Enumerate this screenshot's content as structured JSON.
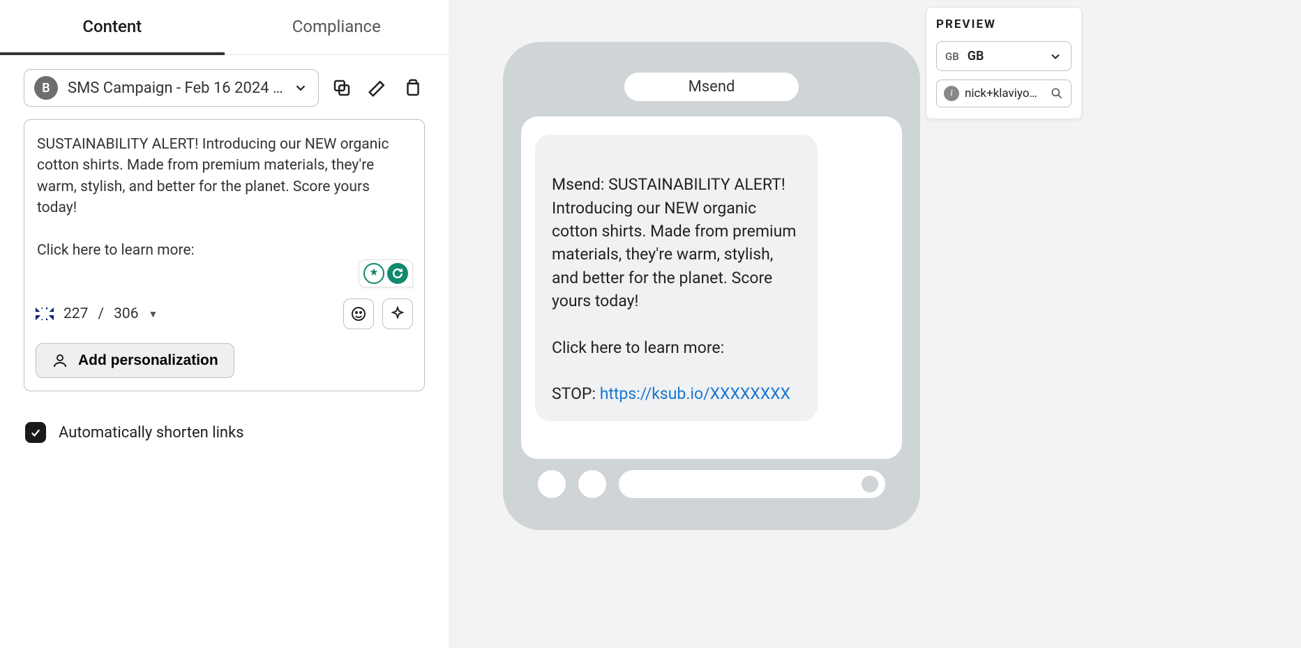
{
  "tabs": {
    "content": "Content",
    "compliance": "Compliance"
  },
  "campaign": {
    "badge": "B",
    "name": "SMS Campaign - Feb 16 2024 …"
  },
  "message": {
    "text": "SUSTAINABILITY ALERT! Introducing our NEW organic cotton shirts. Made from premium materials, they're warm, stylish, and better for the planet. Score yours today!\n\nClick here to learn more:"
  },
  "char_count": {
    "used": "227",
    "sep": "/",
    "total": "306"
  },
  "personalization_button": "Add personalization",
  "shorten_label": "Automatically shorten links",
  "phone": {
    "sender": "Msend",
    "bubble_text": "Msend: SUSTAINABILITY ALERT! Introducing our NEW organic cotton shirts. Made from premium materials, they're warm, stylish, and better for the planet. Score yours today!\n\nClick here to learn more:",
    "stop_prefix": "STOP: ",
    "stop_link": "https://ksub.io/XXXXXXXX"
  },
  "preview": {
    "title": "PREVIEW",
    "country_code": "GB",
    "country_name": "GB",
    "profile": "nick+klaviyo…"
  }
}
